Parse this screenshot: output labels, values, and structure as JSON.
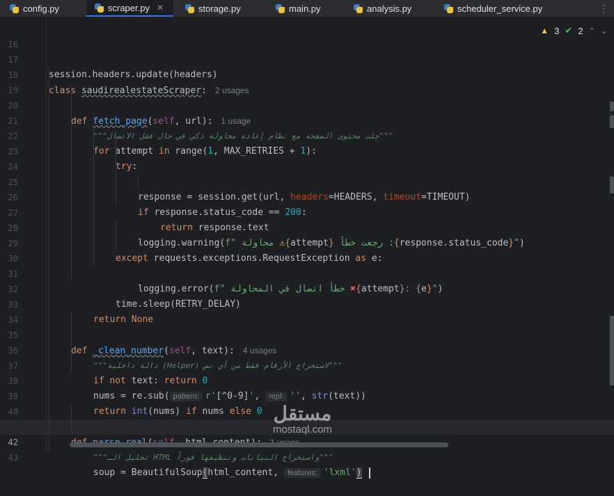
{
  "tabs": [
    {
      "label": "config.py",
      "active": false
    },
    {
      "label": "scraper.py",
      "active": true
    },
    {
      "label": "storage.py",
      "active": false
    },
    {
      "label": "main.py",
      "active": false
    },
    {
      "label": "analysis.py",
      "active": false
    },
    {
      "label": "scheduler_service.py",
      "active": false
    }
  ],
  "tab_close_glyph": "✕",
  "more_glyph": "⋮",
  "inspections": {
    "warnings": "3",
    "weak_warnings": "2"
  },
  "line_numbers": [
    "16",
    "17",
    "18",
    "19",
    "20",
    "21",
    "22",
    "23",
    "24",
    "25",
    "26",
    "27",
    "28",
    "29",
    "30",
    "31",
    "32",
    "33",
    "34",
    "35",
    "36",
    "37",
    "38",
    "39",
    "40",
    "41",
    "42",
    "43"
  ],
  "code": {
    "l17": "session.headers.update(headers)",
    "l18_kw": "class",
    "l18_name": "saudirealestateScraper",
    "l18_colon": ":",
    "l18_hint": "2 usages",
    "l19_kw": "def",
    "l19_name": "fetch_page",
    "l19_open": "(",
    "l19_self": "self",
    "l19_rest": ", url):",
    "l19_hint": "1 usage",
    "l20_doc": "\"\"\"جلب محتوى الصفحة مع نظام إعادة محاولة ذكي في حال فشل الاتصال\"\"\"",
    "l21_for": "for",
    "l21_a": " attempt ",
    "l21_in": "in",
    "l21_range": " range",
    "l21_b": "(",
    "l21_one": "1",
    "l21_c": ", MAX_RETRIES + ",
    "l21_one2": "1",
    "l21_d": "):",
    "l22_try": "try",
    "l22_colon": ":",
    "l24_a": "response = session.get(url, ",
    "l24_p1": "headers",
    "l24_b": "=HEADERS, ",
    "l24_p2": "timeout",
    "l24_c": "=TIMEOUT)",
    "l25_if": "if",
    "l25_a": " response.status_code == ",
    "l25_num": "200",
    "l25_b": ":",
    "l26_ret": "return",
    "l26_a": " response.text",
    "l27_a": "logging.warning(",
    "l27_f": "f\" محاولة ",
    "l27_warn": "⚠",
    "l27_b1": "{",
    "l27_v1": "attempt",
    "l27_b2": "}",
    "l27_mid": " رجعت خطأ :",
    "l27_b3": "{",
    "l27_v2": "response.status_code",
    "l27_b4": "}",
    "l27_end": "\"",
    "l27_close": ")",
    "l28_except": "except",
    "l28_a": " requests.exceptions.RequestException ",
    "l28_as": "as",
    "l28_b": " e:",
    "l30_a": "logging.error(",
    "l30_f": "f\" خطأ اتصال في المحاولة ",
    "l30_x": "✖",
    "l30_b1": "{",
    "l30_v1": "attempt",
    "l30_b2": "}",
    "l30_colon": ": ",
    "l30_b3": "{",
    "l30_v2": "e",
    "l30_b4": "}",
    "l30_end": "\"",
    "l30_close": ")",
    "l31": "time.sleep(RETRY_DELAY)",
    "l32_ret": "return",
    "l32_none": " None",
    "l34_kw": "def",
    "l34_name": "_clean_number",
    "l34_open": "(",
    "l34_self": "self",
    "l34_rest": ", text):",
    "l34_hint": "4 usages",
    "l35_doc": "\"\"\"دالة داخلية (Helper) لاستخراج الأرقام فقط من أي نص\"\"\"",
    "l36_if": "if",
    "l36_not": " not",
    "l36_a": " text: ",
    "l36_ret": "return",
    "l36_num": " 0",
    "l37_a": "nums = re.sub(",
    "l37_inlay1": "pattern:",
    "l37_r": "r'",
    "l37_rx": "[^0-9]",
    "l37_r2": "'",
    "l37_b": ", ",
    "l37_inlay2": "repl:",
    "l37_s": "''",
    "l37_c": ", ",
    "l37_str": "str",
    "l37_d": "(text))",
    "l38_ret": "return",
    "l38_int": " int",
    "l38_a": "(nums) ",
    "l38_if": "if",
    "l38_b": " nums ",
    "l38_else": "else",
    "l38_num": " 0",
    "l40_kw": "def",
    "l40_name": "parse_real",
    "l40_open": "(",
    "l40_self": "self",
    "l40_rest": ", html_content):",
    "l40_hint": "1 usage",
    "l41_doc": "\"\"\"تحليل الـ HTML واستخراج البيانات وتنظيفها فوراً\"\"\"",
    "l42_a": "soup = BeautifulSoup",
    "l42_paren": "(",
    "l42_b": "html_content, ",
    "l42_inlay": "features:",
    "l42_s": "'lxml'",
    "l42_close": ")"
  },
  "watermark": {
    "arabic": "مستقل",
    "latin": "mostaql.com"
  },
  "colors": {
    "keyword": "#cf8e6d",
    "function": "#56a8f5",
    "number": "#2aacb8",
    "string": "#6aab73",
    "self": "#94558d",
    "docstring": "#5f826b",
    "parameter": "#aa4926"
  }
}
